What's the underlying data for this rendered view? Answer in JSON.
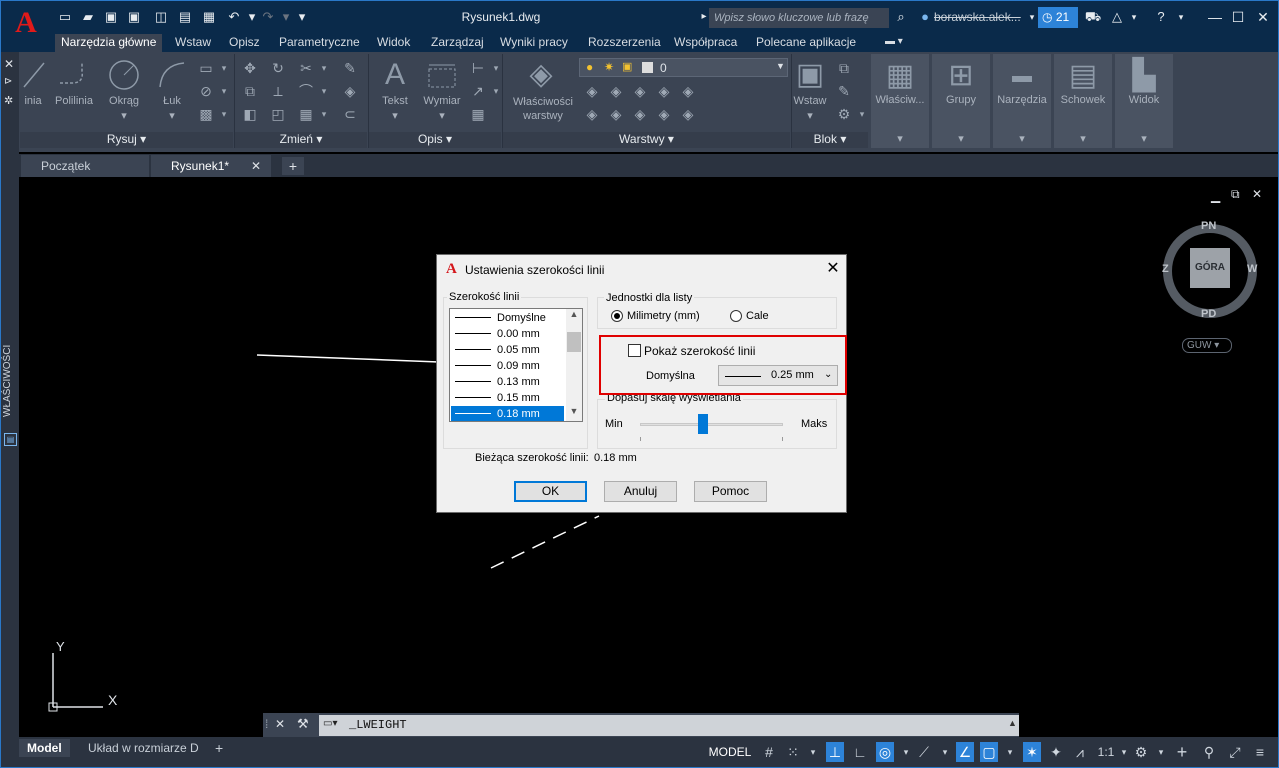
{
  "titlebar": {
    "doc_title": "Rysunek1.dwg",
    "search_placeholder": "Wpisz słowo kluczowe lub frazę",
    "user": "borawska.alek...",
    "notification_count": "21"
  },
  "ribbon": {
    "tabs": [
      "Narzędzia główne",
      "Wstaw",
      "Opisz",
      "Parametryczne",
      "Widok",
      "Zarządzaj",
      "Wyniki pracy",
      "Rozszerzenia",
      "Współpraca",
      "Polecane aplikacje"
    ],
    "active_tab": "Narzędzia główne",
    "panels": {
      "rysuj": {
        "label": "Rysuj",
        "buttons": [
          "inia",
          "Polilinia",
          "Okrąg",
          "Łuk"
        ]
      },
      "zmien": {
        "label": "Zmień"
      },
      "opis": {
        "label": "Opis",
        "buttons": [
          "Tekst",
          "Wymiar"
        ]
      },
      "warstwy": {
        "label": "Warstwy",
        "layer_value": "0",
        "buttons": [
          "Właściwości warstwy"
        ]
      },
      "blok": {
        "label": "Blok",
        "buttons": [
          "Wstaw"
        ]
      },
      "collapsed": [
        "Właściw...",
        "Grupy",
        "Narzędzia",
        "Schowek",
        "Widok"
      ]
    }
  },
  "left_palette": {
    "label": "WŁAŚCIWOŚCI"
  },
  "doc_tabs": {
    "home": "Początek",
    "current": "Rysunek1*"
  },
  "viewcube": {
    "top": "GÓRA",
    "north": "PN",
    "south": "PD",
    "east": "W",
    "west": "Z",
    "ucs": "GUW"
  },
  "ucs_icon": {
    "y": "Y",
    "x": "X"
  },
  "command_line": {
    "text": "_LWEIGHT"
  },
  "status_bar": {
    "layout_tabs": [
      "Model",
      "Układ w rozmiarze D"
    ],
    "model_label": "MODEL",
    "scale": "1:1"
  },
  "dialog": {
    "title": "Ustawienia szerokości linii",
    "lineweights_label": "Szerokość linii",
    "lineweights": [
      "Domyślne",
      "0.00 mm",
      "0.05 mm",
      "0.09 mm",
      "0.13 mm",
      "0.15 mm",
      "0.18 mm"
    ],
    "selected": "0.18 mm",
    "units_label": "Jednostki dla listy",
    "unit_mm": "Milimetry (mm)",
    "unit_inch": "Cale",
    "show_lineweight": "Pokaż szerokość linii",
    "default_label": "Domyślna",
    "default_value": "0.25 mm",
    "scale_label": "Dopasuj skalę wyświetlania",
    "min_label": "Min",
    "max_label": "Maks",
    "current_label": "Bieżąca szerokość linii:",
    "current_value": "0.18 mm",
    "ok": "OK",
    "cancel": "Anuluj",
    "help": "Pomoc"
  }
}
